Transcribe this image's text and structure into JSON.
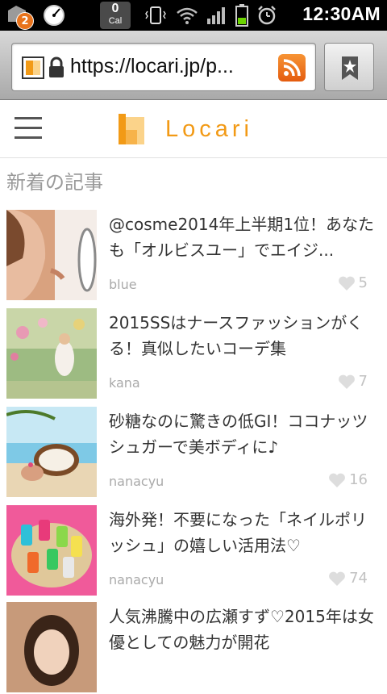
{
  "status_bar": {
    "notification_count": "2",
    "calendar_number": "0",
    "calendar_label": "Cal",
    "time": "12:30AM"
  },
  "browser": {
    "url": "https://locari.jp/p..."
  },
  "site": {
    "logo_text": "Locari",
    "brand_color": "#f29a16"
  },
  "section": {
    "title": "新着の記事"
  },
  "articles": [
    {
      "title": "@cosme2014年上半期1位！あなたも「オルビスユー」でエイジ...",
      "author": "blue",
      "likes": "5"
    },
    {
      "title": "2015SSはナースファッションがくる！真似したいコーデ集",
      "author": "kana",
      "likes": "7"
    },
    {
      "title": "砂糖なのに驚きの低GI！ココナッツシュガーで美ボディに♪",
      "author": "nanacyu",
      "likes": "16"
    },
    {
      "title": "海外発！不要になった「ネイルポリッシュ」の嬉しい活用法♡",
      "author": "nanacyu",
      "likes": "74"
    },
    {
      "title": "人気沸騰中の広瀬すず♡2015年は女優としての魅力が開花",
      "author": "",
      "likes": ""
    }
  ]
}
